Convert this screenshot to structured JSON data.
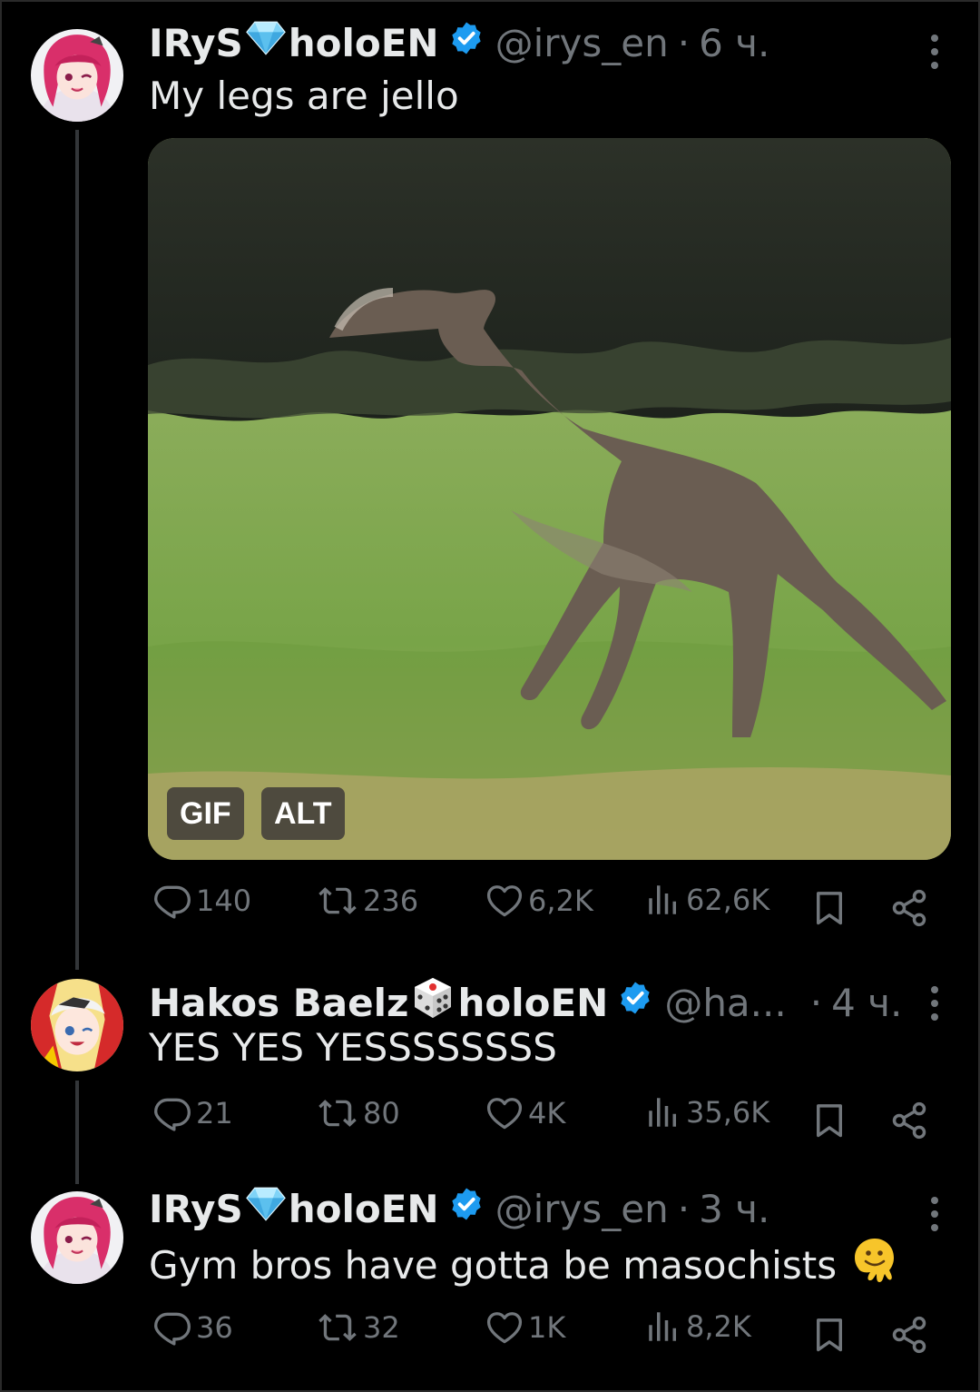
{
  "tweets": [
    {
      "name_a": "IRyS",
      "name_b": "holoEN",
      "handle": "@irys_en",
      "sep": "·",
      "time": "6 ч.",
      "text": "My legs are jello",
      "media": {
        "badge_gif": "GIF",
        "badge_alt": "ALT"
      },
      "stats": {
        "replies": "140",
        "reposts": "236",
        "likes": "6,2K",
        "views": "62,6K"
      }
    },
    {
      "name_a": "Hakos Baelz",
      "name_b": "holoEN",
      "handle": "@ha...",
      "sep": "·",
      "time": "4 ч.",
      "text": "YES YES YESSSSSSSS",
      "stats": {
        "replies": "21",
        "reposts": "80",
        "likes": "4K",
        "views": "35,6K"
      }
    },
    {
      "name_a": "IRyS",
      "name_b": "holoEN",
      "handle": "@irys_en",
      "sep": "·",
      "time": "3 ч.",
      "text": "Gym bros have gotta be masochists",
      "stats": {
        "replies": "36",
        "reposts": "32",
        "likes": "1K",
        "views": "8,2K"
      }
    }
  ],
  "colors": {
    "background": "#000000",
    "text": "#e7e9ea",
    "muted": "#71767b",
    "verified": "#1d9bf0",
    "thread_line": "#333639"
  },
  "icons": [
    "more-icon",
    "verified-icon",
    "diamond-icon",
    "dice-icon",
    "reply-icon",
    "repost-icon",
    "like-icon",
    "views-icon",
    "bookmark-icon",
    "share-icon",
    "melting-face-emoji"
  ]
}
